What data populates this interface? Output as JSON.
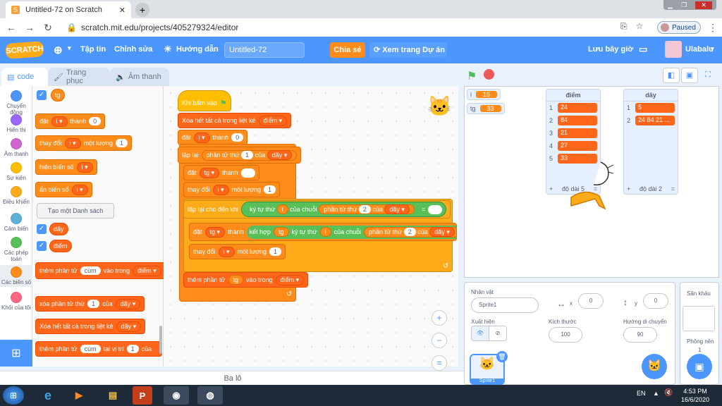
{
  "browser": {
    "tab_title": "Untitled-72 on Scratch",
    "url": "scratch.mit.edu/projects/405279324/editor",
    "paused_label": "Paused"
  },
  "menubar": {
    "logo": "SCRATCH",
    "file": "Tập tin",
    "edit": "Chỉnh sửa",
    "tutorials": "Hướng dẫn",
    "project_title": "Untitled-72",
    "share": "Chia sẻ",
    "see_project": "Xem trang Dự án",
    "save_now": "Lưu bây giờ",
    "username": "Ulabalu"
  },
  "editor_tabs": {
    "code": "code",
    "costumes": "Trang phục",
    "sounds": "Âm thanh"
  },
  "categories": [
    {
      "label": "Chuyển động",
      "color": "#4c97ff"
    },
    {
      "label": "Hiển thị",
      "color": "#9966ff"
    },
    {
      "label": "Âm thanh",
      "color": "#cf63cf"
    },
    {
      "label": "Sự kiện",
      "color": "#ffbf00"
    },
    {
      "label": "Điều khiển",
      "color": "#ffab19"
    },
    {
      "label": "Cảm biến",
      "color": "#5cb1d6"
    },
    {
      "label": "Các phép toán",
      "color": "#59c059"
    },
    {
      "label": "Các biến số",
      "color": "#ff8c1a"
    },
    {
      "label": "Khối của tôi",
      "color": "#ff6680"
    }
  ],
  "palette": {
    "var_tg": "tg",
    "set": "đặt",
    "var_i": "i",
    "to": "thành",
    "set_val": "0",
    "change": "thay đổi",
    "by": "một lượng",
    "change_val": "1",
    "show": "hiện biến số",
    "hide": "ẩn biến số",
    "make_list": "Tạo một Danh sách",
    "list_day": "dãy",
    "list_diem": "điểm",
    "add": "thêm phần tử",
    "add_val": "cùm",
    "to_list": "vào trong",
    "delete": "xóa phần tử thứ",
    "delete_val": "1",
    "of": "của",
    "delete_all": "Xóa hết tất cả trong liệt kê",
    "insert": "thêm phần tử",
    "insert_val": "cùm",
    "at": "tại vị trí",
    "insert_pos": "1",
    "insert_of": "của"
  },
  "script": {
    "hat": "Khi bấm vào",
    "b1": "Xóa hết tất cả trong liệt kê",
    "b1_list": "điểm",
    "b2": "đặt",
    "b2_var": "i",
    "b2_to": "thành",
    "b2_val": "0",
    "b3": "lặp lại",
    "b3_item": "phần tử thứ",
    "b3_n": "1",
    "b3_of": "của",
    "b3_list": "dãy",
    "b4": "đặt",
    "b4_var": "tg",
    "b4_to": "thành",
    "b4_val": "",
    "b5": "thay đổi",
    "b5_var": "i",
    "b5_by": "một lượng",
    "b5_val": "1",
    "b6": "lặp lại cho đến khi",
    "b6_letter": "ký tự thứ",
    "b6_i": "i",
    "b6_ofstr": "của chuỗi",
    "b6_item": "phần tử thứ",
    "b6_n": "2",
    "b6_of": "của",
    "b6_list": "dãy",
    "b6_eq": "=",
    "b6_val": "",
    "b7": "đặt",
    "b7_var": "tg",
    "b7_to": "thành",
    "b7_join": "kết hợp",
    "b7_tg": "tg",
    "b7_letter": "ký tự thứ",
    "b7_i": "i",
    "b7_ofstr": "của chuỗi",
    "b7_item": "phần tử thứ",
    "b7_n": "2",
    "b7_of": "của",
    "b7_list": "dãy",
    "b8": "thay đổi",
    "b8_var": "i",
    "b8_by": "một lượng",
    "b8_val": "1",
    "b9": "thêm phần tử",
    "b9_val": "tg",
    "b9_to": "vào trong",
    "b9_list": "điểm"
  },
  "backpack": "Ba lô",
  "stage": {
    "mon_i_name": "i",
    "mon_i_val": "15",
    "mon_tg_name": "tg",
    "mon_tg_val": "33",
    "list_diem": {
      "title": "điểm",
      "items": [
        "24",
        "84",
        "21",
        "27",
        "33"
      ],
      "indices": [
        "1",
        "2",
        "3",
        "4",
        "5"
      ],
      "add": "+",
      "length": "độ dài 5",
      "eq": "="
    },
    "list_day": {
      "title": "dãy",
      "items": [
        "5",
        "24 84 21 ..."
      ],
      "indices": [
        "1",
        "2"
      ],
      "add": "+",
      "length": "độ dài 2",
      "eq": "="
    }
  },
  "sprite_panel": {
    "sprite_label": "Nhân vật",
    "sprite_name": "Sprite1",
    "x_label": "x",
    "x_val": "0",
    "y_label": "y",
    "y_val": "0",
    "show_label": "Xuất hiện",
    "size_label": "Kích thước",
    "size_val": "100",
    "dir_label": "Hướng di chuyển",
    "dir_val": "90",
    "thumb_name": "Sprite1"
  },
  "stage_panel": {
    "label": "Sân khấu",
    "backdrops_label": "Phông nền",
    "backdrops_count": "1"
  },
  "taskbar": {
    "lang": "EN",
    "time": "4:53 PM",
    "date": "16/6/2020"
  }
}
